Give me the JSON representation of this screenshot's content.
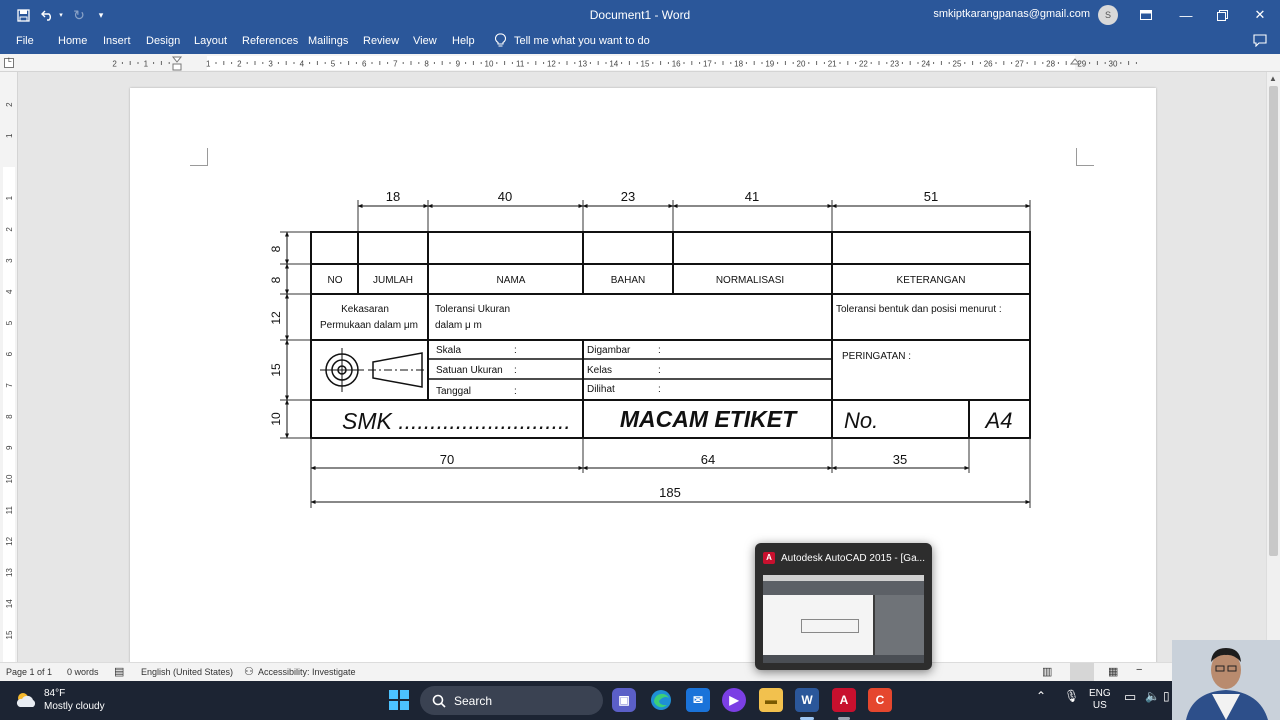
{
  "window": {
    "title": "Document1  -  Word",
    "account_email": "smkiptkarangpanas@gmail.com",
    "account_initial": "S",
    "qat": {
      "save_icon": "save-icon",
      "undo_icon": "undo-icon",
      "redo_icon": "redo-icon"
    }
  },
  "ribbon": {
    "tabs": [
      "File",
      "Home",
      "Insert",
      "Design",
      "Layout",
      "References",
      "Mailings",
      "Review",
      "View",
      "Help"
    ],
    "tell_me": "Tell me what you want to do"
  },
  "ruler": {
    "h_labels": [
      "2",
      "1",
      "1",
      "2",
      "3",
      "4",
      "5",
      "6",
      "7",
      "8",
      "9",
      "10",
      "11",
      "12",
      "13",
      "14",
      "15",
      "16",
      "17",
      "18",
      "19",
      "20",
      "21",
      "22",
      "23",
      "24",
      "25",
      "26",
      "27",
      "28",
      "29",
      "30"
    ],
    "v_labels": [
      "2",
      "1",
      "1",
      "2",
      "3",
      "4",
      "5",
      "6",
      "7",
      "8",
      "9",
      "10",
      "11",
      "12",
      "13",
      "14",
      "15"
    ]
  },
  "drawing": {
    "top_dims": [
      "18",
      "40",
      "23",
      "41",
      "51"
    ],
    "side_dims": [
      "8",
      "8",
      "12",
      "15",
      "10"
    ],
    "headers": [
      "NO",
      "JUMLAH",
      "NAMA",
      "BAHAN",
      "NORMALISASI",
      "KETERANGAN"
    ],
    "kekasaran_1": "Kekasaran",
    "kekasaran_2": "Permukaan dalam μm",
    "toleransi_1": "Toleransi Ukuran",
    "toleransi_2": "dalam    μ m",
    "toleransi_bentuk": "Toleransi bentuk dan posisi menurut :",
    "skala": "Skala",
    "satuan": "Satuan Ukuran",
    "tanggal": "Tanggal",
    "digambar": "Digambar",
    "kelas": "Kelas",
    "dilihat": "Dilihat",
    "colon": ":",
    "peringatan": "PERINGATAN :",
    "smk": "SMK ...........................",
    "macam": "MACAM ETIKET",
    "no": "No.",
    "a4": "A4",
    "bottom_dims": [
      "70",
      "64",
      "35"
    ],
    "total_dim": "185"
  },
  "statusbar": {
    "page": "Page 1 of 1",
    "words": "0 words",
    "language": "English (United States)",
    "accessibility": "Accessibility: Investigate"
  },
  "taskbar": {
    "temp": "84°F",
    "weather": "Mostly cloudy",
    "search": "Search",
    "lang_1": "ENG",
    "lang_2": "US"
  },
  "preview": {
    "caption": "Autodesk AutoCAD 2015 - [Ga..."
  },
  "colors": {
    "word_blue": "#2b579a",
    "taskbar": "#1c2433",
    "autocad_red": "#c8102e"
  }
}
